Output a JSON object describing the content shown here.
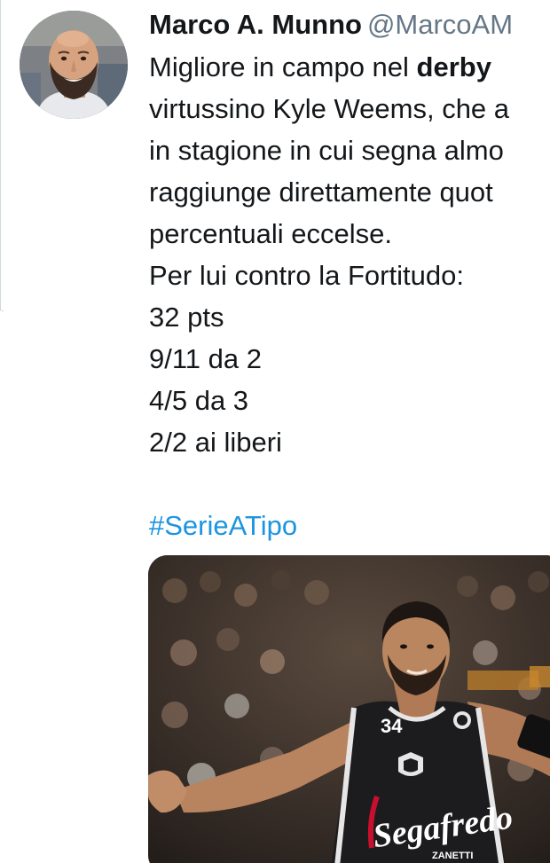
{
  "tweet": {
    "author_name": "Marco A. Munno",
    "author_handle": "@MarcoAM",
    "text_line_1_prefix": "Migliore in campo nel ",
    "text_line_1_bold": "derby",
    "text_line_1_suffix": " ",
    "text_line_2": "virtussino Kyle Weems, che a",
    "text_line_3": "in stagione in cui segna almo",
    "text_line_4": "raggiunge direttamente quot",
    "text_line_5": "percentuali eccelse.",
    "text_line_6": "Per lui contro la Fortitudo:",
    "stat_points": "32 pts",
    "stat_two_pointers": "9/11 da 2",
    "stat_three_pointers": "4/5 da 3",
    "stat_free_throws": "2/2 ai liberi",
    "hashtag": "#SerieATipo"
  },
  "media": {
    "jersey_number": "34",
    "sponsor_text": "Segafredo",
    "sponsor_sub": "ZANETTI"
  },
  "colors": {
    "name": "#14171a",
    "handle": "#657786",
    "hashtag": "#1b95e0",
    "jersey": "#1c1c1e",
    "sponsor": "#c8102e"
  },
  "icons": {
    "avatar": "profile-photo",
    "media": "basketball-player-photo"
  }
}
